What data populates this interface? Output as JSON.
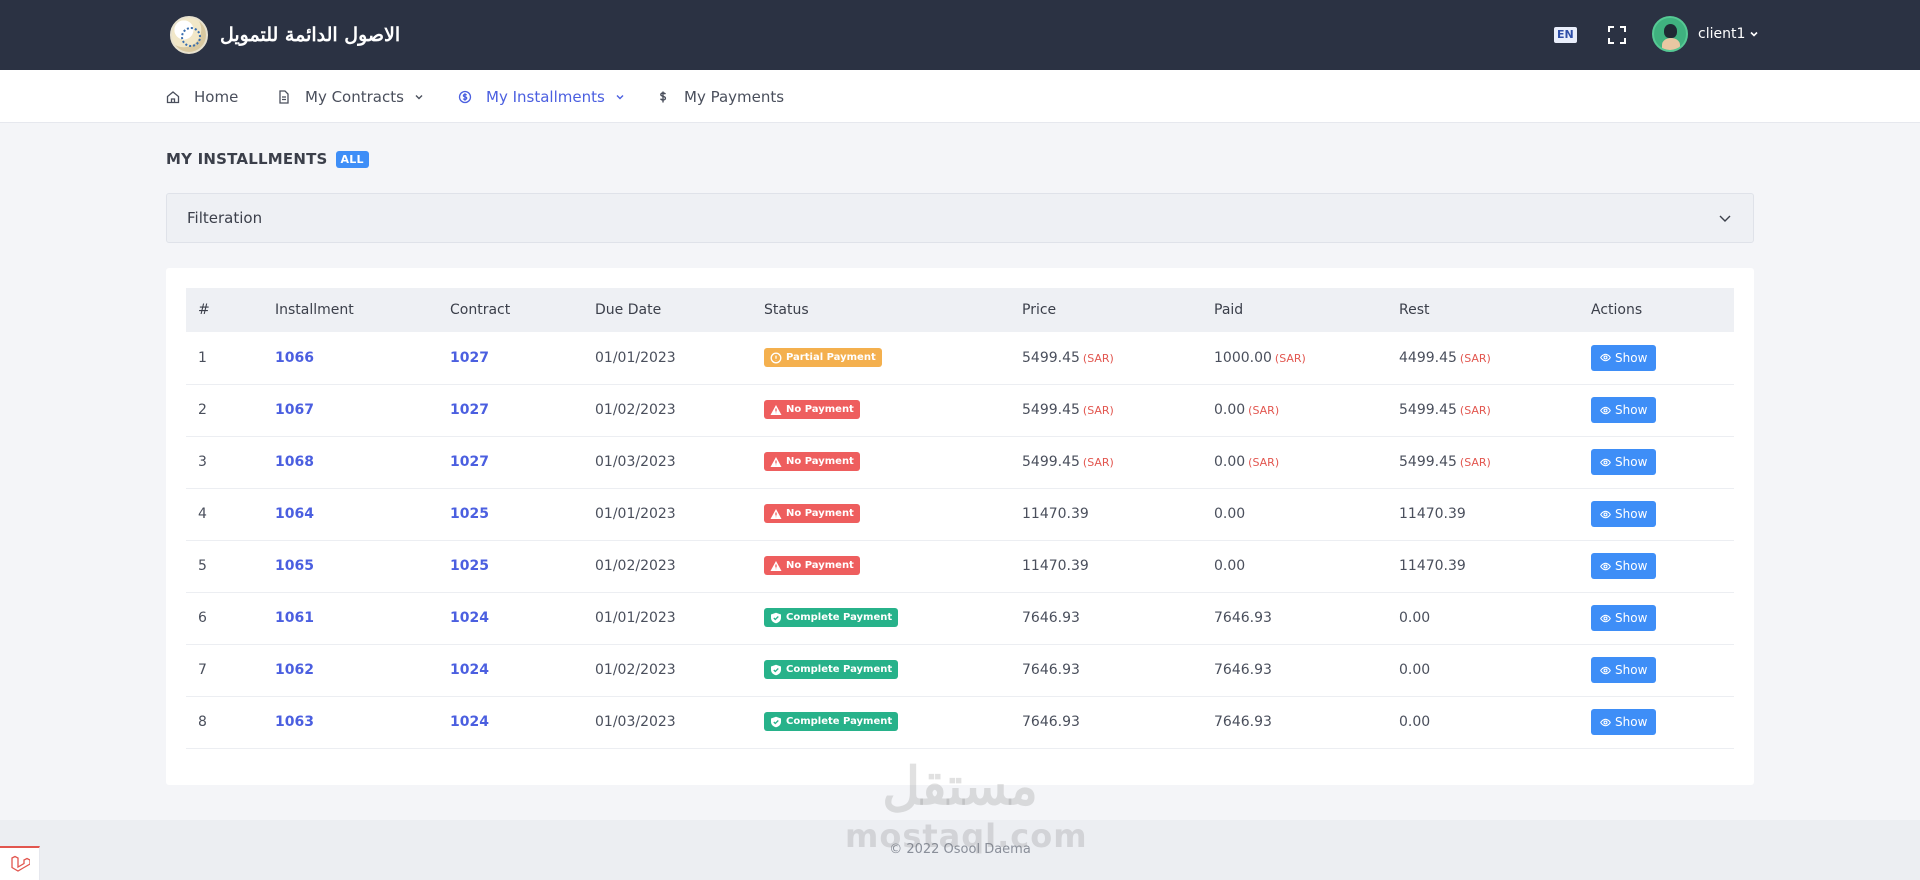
{
  "header": {
    "brand_name": "الاصول الدائمة للتمويل",
    "language": "EN",
    "user": "client1"
  },
  "nav": {
    "items": [
      {
        "label": "Home",
        "icon": "home-icon"
      },
      {
        "label": "My Contracts",
        "icon": "document-icon"
      },
      {
        "label": "My Installments",
        "icon": "coin-icon"
      },
      {
        "label": "My Payments",
        "icon": "dollar-icon"
      }
    ]
  },
  "page": {
    "title": "MY INSTALLMENTS",
    "badge": "ALL",
    "filter_label": "Filteration"
  },
  "table": {
    "headers": [
      "#",
      "Installment",
      "Contract",
      "Due Date",
      "Status",
      "Price",
      "Paid",
      "Rest",
      "Actions"
    ],
    "currency": "(SAR)",
    "show_label": "Show",
    "rows": [
      {
        "no": "1",
        "installment": "1066",
        "contract": "1027",
        "due_date": "01/01/2023",
        "status": "Partial Payment",
        "price": "5499.45",
        "paid": "1000.00",
        "rest": "4499.45",
        "currency": "(SAR)"
      },
      {
        "no": "2",
        "installment": "1067",
        "contract": "1027",
        "due_date": "01/02/2023",
        "status": "No Payment",
        "price": "5499.45",
        "paid": "0.00",
        "rest": "5499.45",
        "currency": "(SAR)"
      },
      {
        "no": "3",
        "installment": "1068",
        "contract": "1027",
        "due_date": "01/03/2023",
        "status": "No Payment",
        "price": "5499.45",
        "paid": "0.00",
        "rest": "5499.45",
        "currency": "(SAR)"
      },
      {
        "no": "4",
        "installment": "1064",
        "contract": "1025",
        "due_date": "01/01/2023",
        "status": "No Payment",
        "price": "11470.39",
        "paid": "0.00",
        "rest": "11470.39",
        "currency": ""
      },
      {
        "no": "5",
        "installment": "1065",
        "contract": "1025",
        "due_date": "01/02/2023",
        "status": "No Payment",
        "price": "11470.39",
        "paid": "0.00",
        "rest": "11470.39",
        "currency": ""
      },
      {
        "no": "6",
        "installment": "1061",
        "contract": "1024",
        "due_date": "01/01/2023",
        "status": "Complete Payment",
        "price": "7646.93",
        "paid": "7646.93",
        "rest": "0.00",
        "currency": ""
      },
      {
        "no": "7",
        "installment": "1062",
        "contract": "1024",
        "due_date": "01/02/2023",
        "status": "Complete Payment",
        "price": "7646.93",
        "paid": "7646.93",
        "rest": "0.00",
        "currency": ""
      },
      {
        "no": "8",
        "installment": "1063",
        "contract": "1024",
        "due_date": "01/03/2023",
        "status": "Complete Payment",
        "price": "7646.93",
        "paid": "7646.93",
        "rest": "0.00",
        "currency": ""
      }
    ]
  },
  "footer": {
    "copyright": "© 2022 Osool Daema",
    "watermark_ar": "مستقل",
    "watermark_en": "mostaql.com"
  },
  "colors": {
    "topbar": "#2b3243",
    "accent": "#4b5fe0",
    "button": "#3e8ef7",
    "partial": "#f4b04e",
    "none": "#ee5e5e",
    "complete": "#27b28a"
  }
}
